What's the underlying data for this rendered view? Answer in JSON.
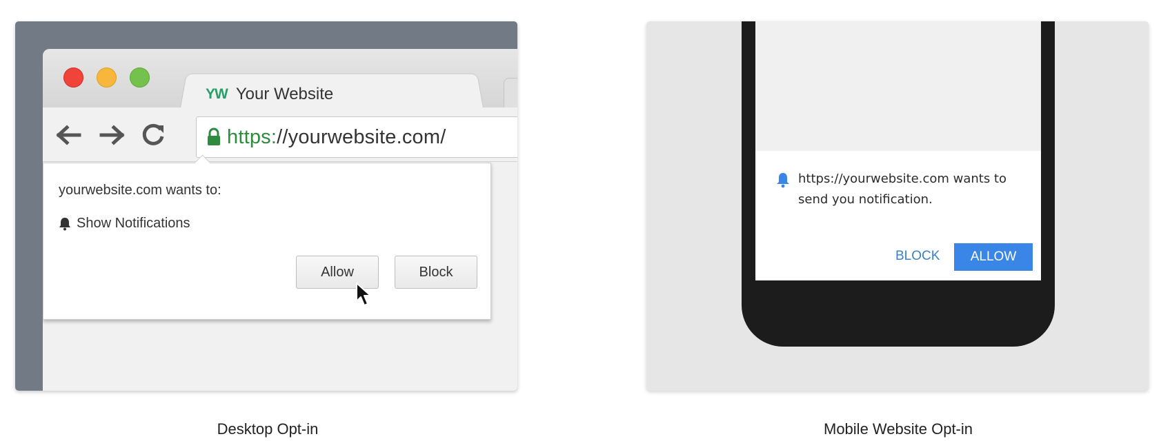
{
  "desktop": {
    "tab": {
      "logo": "YW",
      "title": "Your Website"
    },
    "address_bar": {
      "scheme": "https:",
      "rest": "//yourwebsite.com/"
    },
    "permission_popup": {
      "heading": "yourwebsite.com wants to:",
      "permission": "Show Notifications",
      "allow_label": "Allow",
      "block_label": "Block"
    },
    "caption": "Desktop Opt-in"
  },
  "mobile": {
    "notification": {
      "message": "https://yourwebsite.com wants to send you notification.",
      "block_label": "BLOCK",
      "allow_label": "ALLOW"
    },
    "caption": "Mobile Website Opt-in"
  },
  "icons": {
    "back": "arrow-left-icon",
    "forward": "arrow-right-icon",
    "reload": "reload-icon",
    "lock": "lock-icon",
    "bell": "bell-icon",
    "cursor": "cursor-icon"
  },
  "colors": {
    "secure_green": "#2e8b3e",
    "mobile_accent": "#3a86e6",
    "mobile_block_text": "#3a7fc9",
    "traffic_red": "#f0433a",
    "traffic_yellow": "#f6b73c",
    "traffic_green": "#75c14e"
  }
}
